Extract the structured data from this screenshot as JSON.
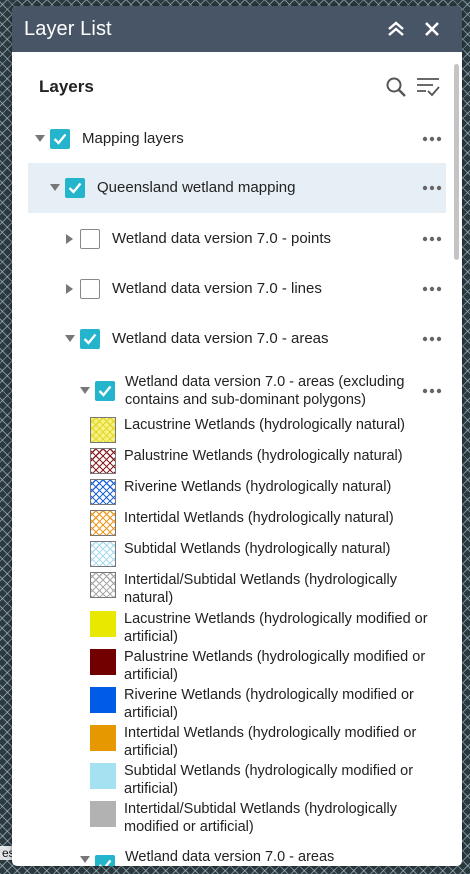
{
  "panel": {
    "title": "Layer List",
    "collapse_icon": "double-chevron-up-icon",
    "close_icon": "close-icon"
  },
  "layers_header": {
    "label": "Layers",
    "search_icon": "search-icon",
    "filter_icon": "filter-list-icon"
  },
  "tree": {
    "mapping_layers": "Mapping layers",
    "qld_wetland": "Queensland wetland mapping",
    "points": "Wetland data version 7.0 - points",
    "lines": "Wetland data version 7.0 - lines",
    "areas": "Wetland data version 7.0 - areas",
    "areas_sub": "Wetland data version 7.0 - areas (excluding contains and sub-dominant polygons)",
    "areas_next": "Wetland data version 7.0 - areas"
  },
  "legend": [
    {
      "label": "Lacustrine Wetlands (hydrologically natural)",
      "color": "#f4f08a",
      "hatch": "#e6d81f"
    },
    {
      "label": "Palustrine Wetlands (hydrologically natural)",
      "color": "#ffffff",
      "hatch": "#8b1f24"
    },
    {
      "label": "Riverine Wetlands (hydrologically natural)",
      "color": "#ffffff",
      "hatch": "#2266dd"
    },
    {
      "label": "Intertidal Wetlands (hydrologically natural)",
      "color": "#ffffff",
      "hatch": "#ee9a22"
    },
    {
      "label": "Subtidal Wetlands (hydrologically natural)",
      "color": "#ffffff",
      "hatch": "#a9dcee"
    },
    {
      "label": "Intertidal/Subtidal Wetlands (hydrologically natural)",
      "color": "#ffffff",
      "hatch": "#aaaaaa"
    },
    {
      "label": "Lacustrine Wetlands (hydrologically modified or artificial)",
      "color": "#e8e800",
      "hatch": ""
    },
    {
      "label": "Palustrine Wetlands (hydrologically modified or artificial)",
      "color": "#730000",
      "hatch": ""
    },
    {
      "label": "Riverine Wetlands (hydrologically modified or artificial)",
      "color": "#005ce6",
      "hatch": ""
    },
    {
      "label": "Intertidal Wetlands (hydrologically modified or artificial)",
      "color": "#e69800",
      "hatch": ""
    },
    {
      "label": "Subtidal Wetlands (hydrologically modified or artificial)",
      "color": "#a4e2f2",
      "hatch": ""
    },
    {
      "label": "Intertidal/Subtidal Wetlands (hydrologically modified or artificial)",
      "color": "#b2b2b2",
      "hatch": ""
    }
  ],
  "map_edge_text": "es",
  "colors": {
    "header_bg": "#485566",
    "checkbox_checked": "#24b5cc",
    "highlight_row": "#e6eef6"
  }
}
